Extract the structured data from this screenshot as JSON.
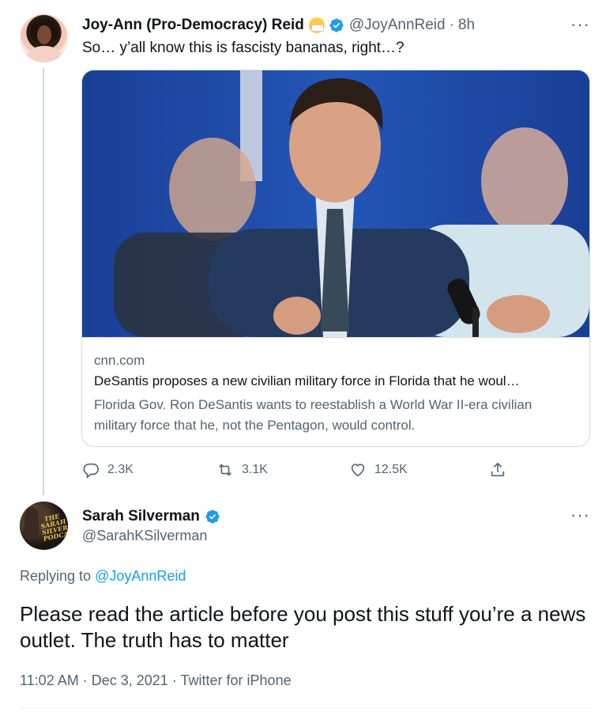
{
  "parent_tweet": {
    "author_name": "Joy-Ann (Pro-Democracy) Reid",
    "handle": "@JoyAnnReid",
    "separator": "·",
    "time_ago": "8h",
    "text": "So… y’all know this is fascisty bananas, right…?",
    "avatar_icon": "avatar-photo",
    "name_emoji": "face-with-medical-mask",
    "card": {
      "domain": "cnn.com",
      "title": "DeSantis proposes a new civilian military force in Florida that he woul…",
      "description": "Florida Gov. Ron DeSantis wants to reestablish a World War II-era civilian military force that he, not the Pentagon, would control."
    },
    "actions": {
      "reply_count": "2.3K",
      "retweet_count": "3.1K",
      "like_count": "12.5K"
    }
  },
  "reply_tweet": {
    "author_name": "Sarah Silverman",
    "handle": "@SarahKSilverman",
    "avatar_label": "THE SARAH SILVERMAN PODCAST",
    "replying_prefix": "Replying to",
    "replying_to": "@JoyAnnReid",
    "text": "Please read the article before you post this stuff you’re a news outlet. The truth has to matter",
    "time": "11:02 AM",
    "date": "Dec 3, 2021",
    "source": "Twitter for iPhone",
    "meta_separator": "·"
  },
  "colors": {
    "accent": "#1d9bf0",
    "secondary_text": "#536471",
    "primary_text": "#0f1419",
    "border": "#cfd9de"
  },
  "icons": {
    "more": "more-dots-icon",
    "verified": "verified-badge-icon",
    "reply": "reply-icon",
    "retweet": "retweet-icon",
    "like": "heart-icon",
    "share": "share-icon"
  }
}
